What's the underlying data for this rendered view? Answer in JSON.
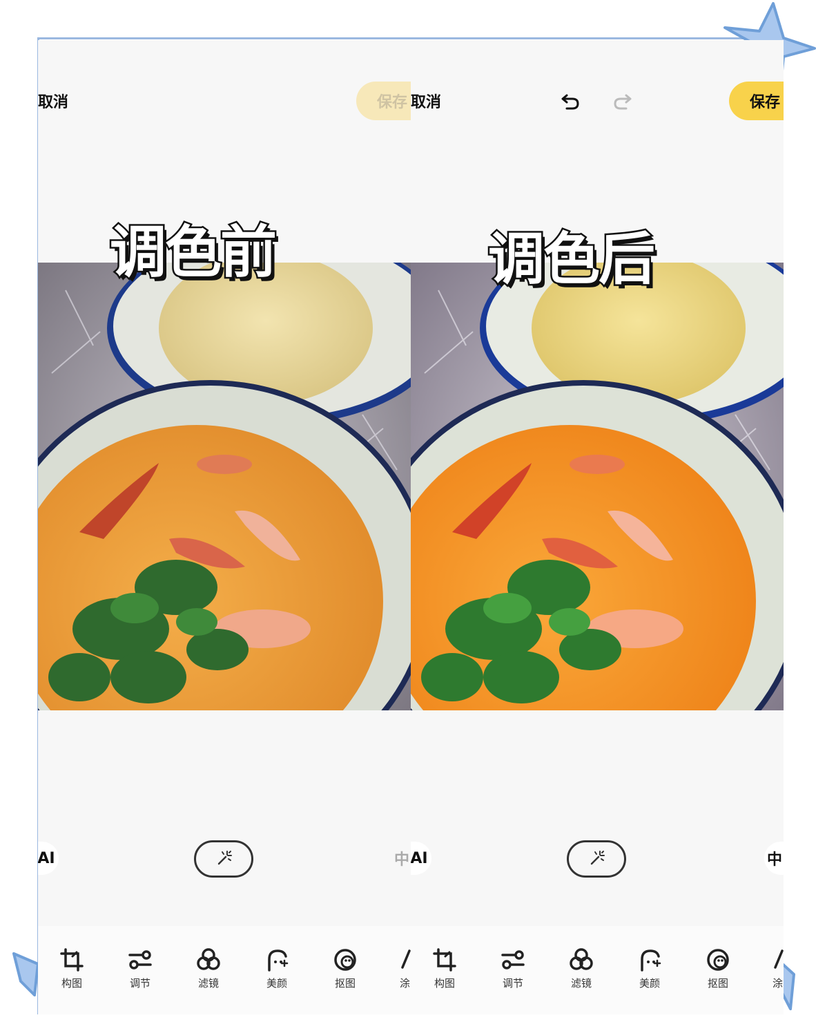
{
  "panels": [
    {
      "caption": "调色前",
      "cancel_label": "取消",
      "save_label": "保存",
      "ai_label": "AI",
      "edge_label": "中",
      "tools": [
        "构图",
        "调节",
        "滤镜",
        "美颜",
        "抠图",
        "涂"
      ]
    },
    {
      "caption": "调色后",
      "cancel_label": "取消",
      "save_label": "保存",
      "ai_label": "AI",
      "edge_label": "中",
      "tools": [
        "构图",
        "调节",
        "滤镜",
        "美颜",
        "抠图",
        "涂"
      ]
    }
  ],
  "colors": {
    "save_active": "#f8d24b",
    "save_disabled": "#f7e8b9",
    "accent_border": "#9bb8e0",
    "soup_before": "#f2a63a",
    "soup_after": "#f79a1e"
  },
  "icons": [
    "crop-icon",
    "adjust-icon",
    "filter-icon",
    "beauty-icon",
    "cutout-icon",
    "magic-wand-icon",
    "undo-icon",
    "redo-icon",
    "star-icon"
  ]
}
